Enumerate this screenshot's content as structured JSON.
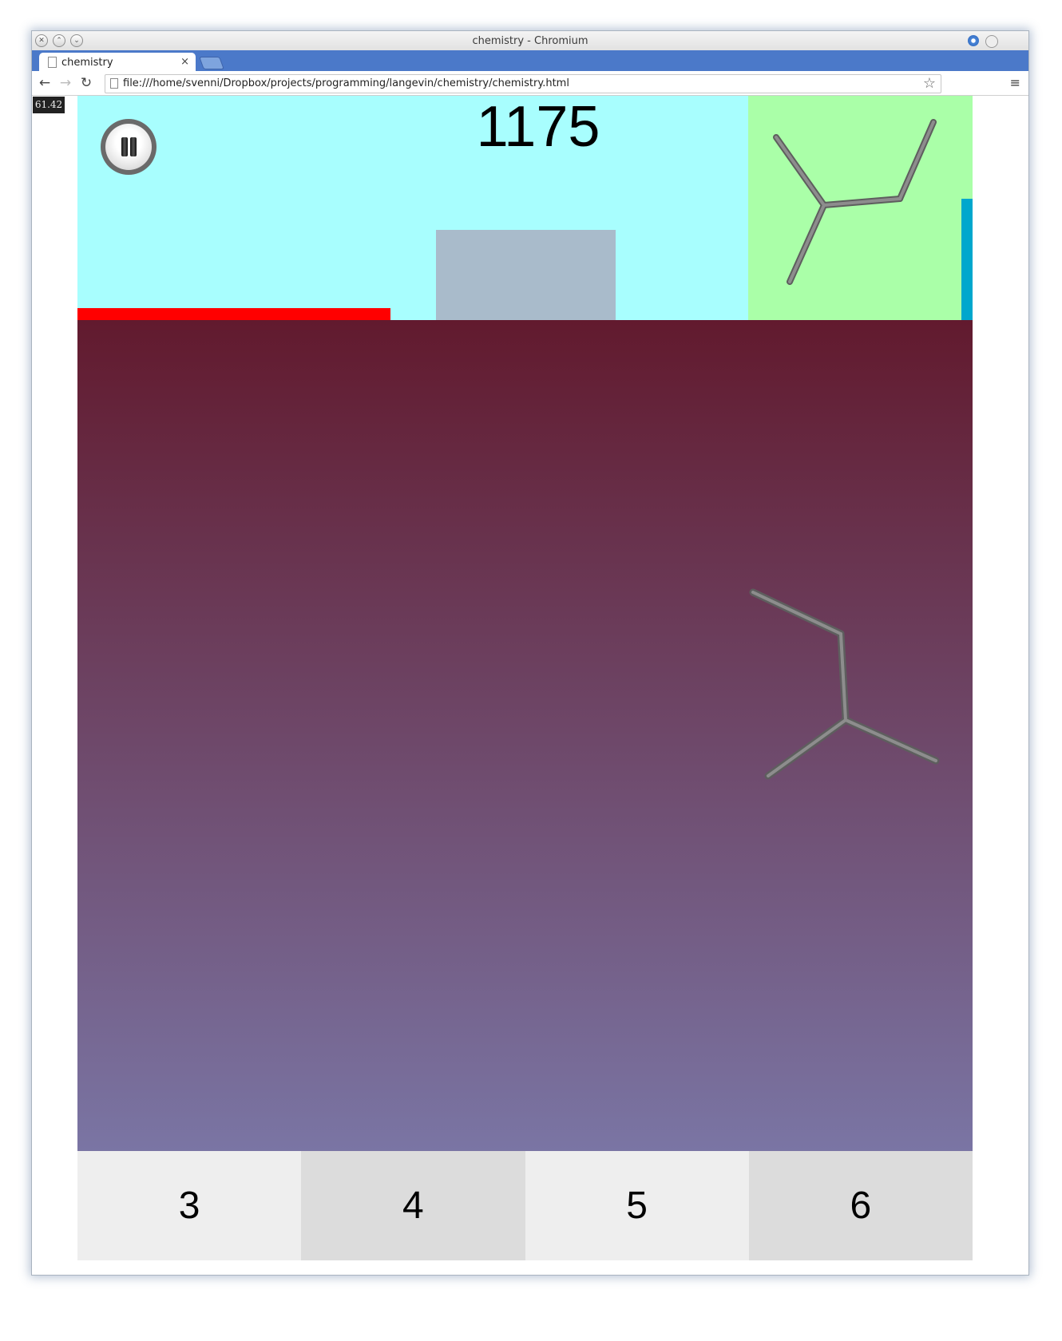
{
  "browser": {
    "window_title": "chemistry - Chromium",
    "tab_title": "chemistry",
    "tab_close": "×",
    "url": "file:///home/svenni/Dropbox/projects/programming/langevin/chemistry/chemistry.html",
    "back_glyph": "←",
    "forward_glyph": "→",
    "reload_glyph": "↻",
    "star_glyph": "☆",
    "menu_glyph": "≡",
    "window_controls": [
      "close-icon",
      "minimize-icon",
      "maximize-icon"
    ]
  },
  "game": {
    "fps": "61.42",
    "score": "1175",
    "progress_fraction": 0.35,
    "timer_fraction": 0.54,
    "answers": [
      "3",
      "4",
      "5",
      "6"
    ],
    "colors": {
      "hud_background": "#a8fefe",
      "target_panel": "#aaffa8",
      "progress_bar": "#ff0000",
      "timer_bar": "#00a7cd",
      "playfield_top": "#621a2e",
      "playfield_bottom": "#7a75a4",
      "bond": "#7b7b7b"
    }
  }
}
